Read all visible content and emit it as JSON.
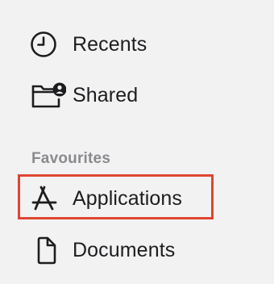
{
  "sidebar": {
    "items_top": [
      {
        "label": "Recents",
        "icon": "clock-icon"
      },
      {
        "label": "Shared",
        "icon": "shared-folder-icon"
      }
    ],
    "favourites": {
      "header": "Favourites",
      "items": [
        {
          "label": "Applications",
          "icon": "applications-icon",
          "highlighted": true
        },
        {
          "label": "Documents",
          "icon": "document-icon"
        }
      ]
    }
  },
  "colors": {
    "background": "#f3f2f3",
    "highlight_border": "#e0452f",
    "section_header": "#8a8a8e",
    "text": "#1d1d1f"
  }
}
